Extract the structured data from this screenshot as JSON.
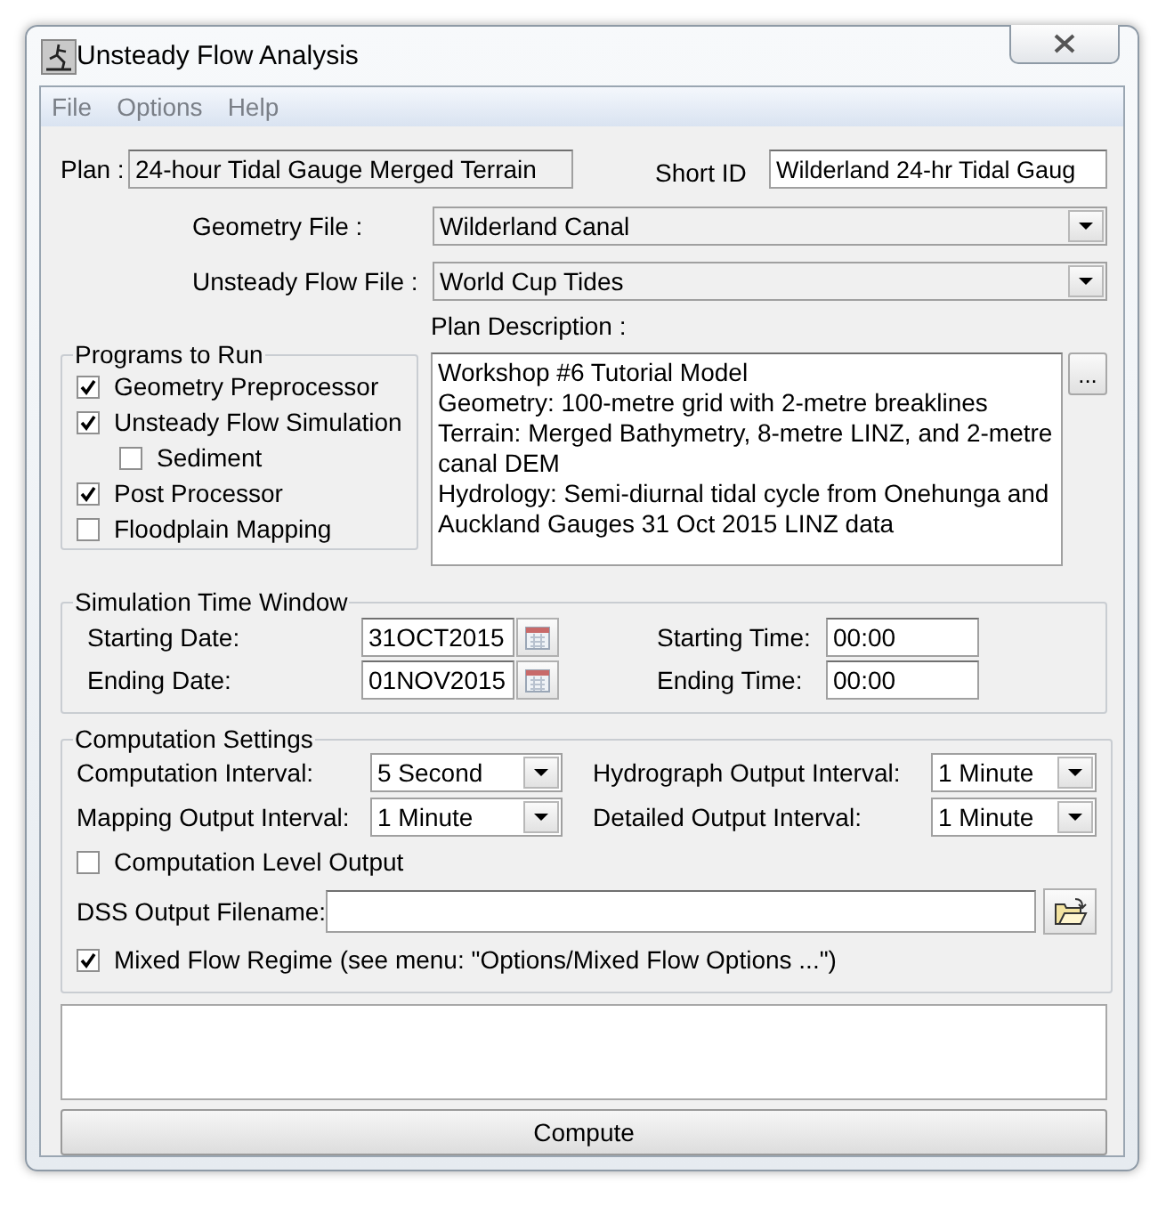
{
  "window": {
    "title": "Unsteady Flow Analysis"
  },
  "menu": [
    "File",
    "Options",
    "Help"
  ],
  "plan": {
    "label": "Plan :",
    "value": "24-hour Tidal Gauge Merged Terrain"
  },
  "short_id": {
    "label": "Short ID",
    "value": "Wilderland 24-hr Tidal Gaug"
  },
  "files": [
    {
      "label": "Geometry File :",
      "value": "Wilderland Canal"
    },
    {
      "label": "Unsteady Flow File :",
      "value": "World Cup Tides"
    }
  ],
  "programs": {
    "title": "Programs to Run",
    "items": [
      {
        "label": "Geometry Preprocessor",
        "checked": true
      },
      {
        "label": "Unsteady Flow Simulation",
        "checked": true,
        "children": [
          {
            "label": "Sediment",
            "checked": false
          }
        ]
      },
      {
        "label": "Post Processor",
        "checked": true
      },
      {
        "label": "Floodplain Mapping",
        "checked": false
      }
    ]
  },
  "plan_description": {
    "label": "Plan Description :",
    "button": "...",
    "lines": [
      "Workshop #6 Tutorial Model",
      "Geometry: 100-metre grid with 2-metre breaklines",
      "Terrain: Merged Bathymetry, 8-metre LINZ, and 2-metre",
      "canal DEM",
      "Hydrology: Semi-diurnal tidal cycle from Onehunga and",
      "Auckland Gauges 31 Oct 2015 LINZ data"
    ]
  },
  "time_window": {
    "title": "Simulation Time Window",
    "rows": [
      {
        "date_label": "Starting Date:",
        "date": "31OCT2015",
        "time_label": "Starting Time:",
        "time": "00:00"
      },
      {
        "date_label": "Ending Date:",
        "date": "01NOV2015",
        "time_label": "Ending Time:",
        "time": "00:00"
      }
    ]
  },
  "computation": {
    "title": "Computation Settings",
    "intervals": [
      {
        "label": "Computation Interval:",
        "value": "5 Second"
      },
      {
        "label": "Hydrograph Output Interval:",
        "value": "1 Minute"
      },
      {
        "label": "Mapping Output Interval:",
        "value": "1 Minute"
      },
      {
        "label": "Detailed Output Interval:",
        "value": "1 Minute"
      }
    ],
    "level_output": {
      "label": "Computation Level Output",
      "checked": false
    },
    "dss": {
      "label": "DSS Output Filename:"
    },
    "mixed_flow": {
      "label": "Mixed Flow Regime (see menu: \"Options/Mixed Flow Options ...\")",
      "checked": true
    }
  },
  "compute_button": "Compute"
}
